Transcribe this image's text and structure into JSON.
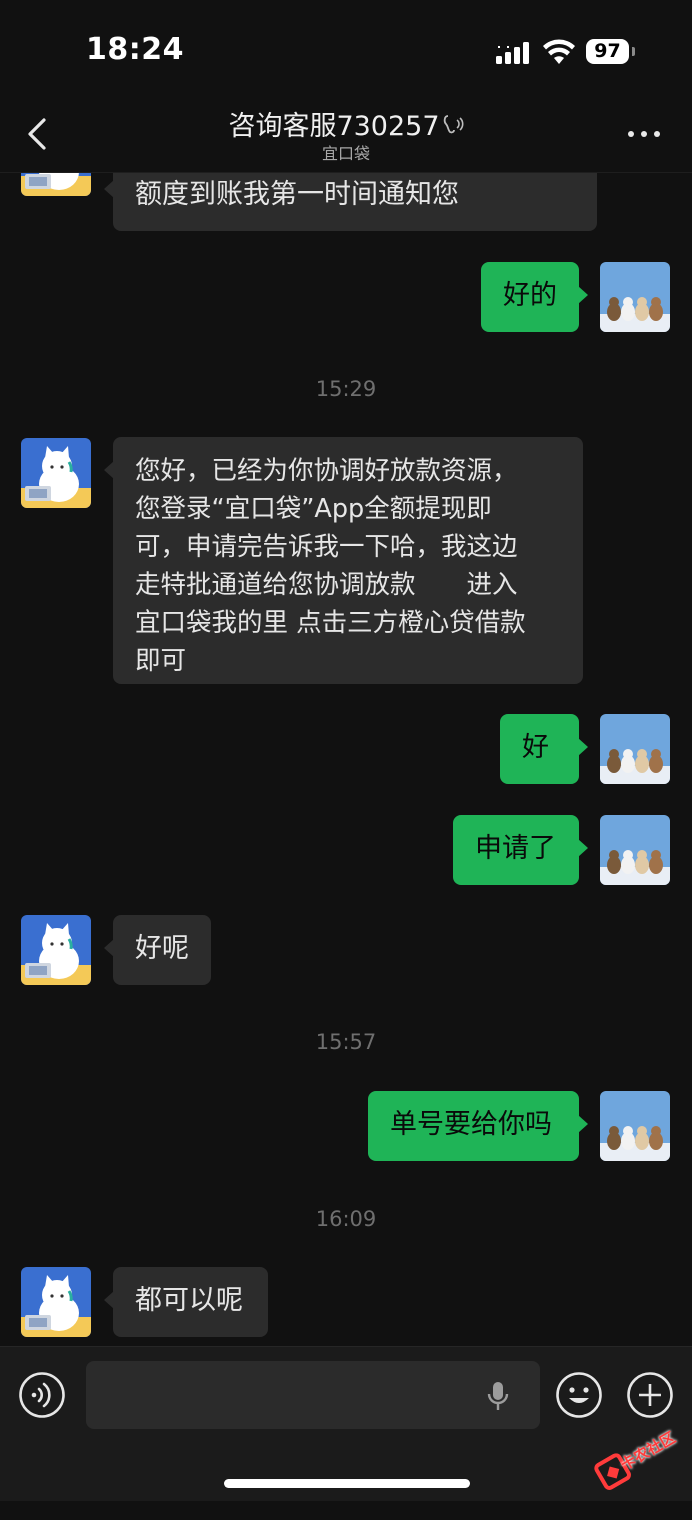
{
  "status_bar": {
    "time": "18:24",
    "battery": "97",
    "icons": [
      "signal-icon",
      "wifi-icon",
      "battery-icon"
    ]
  },
  "header": {
    "title": "咨询客服730257",
    "subtitle": "宜口袋",
    "icons": [
      "back-icon",
      "earpiece-icon",
      "more-icon"
    ]
  },
  "messages": [
    {
      "side": "in",
      "text": "额度到账我第一时间通知您"
    },
    {
      "side": "out",
      "text": "好的"
    },
    {
      "type": "time",
      "text": "15:29"
    },
    {
      "side": "in",
      "text": "您好，已经为你协调好放款资源，\n您登录“宜口袋”App全额提现即\n可，申请完告诉我一下哈，我这边\n走特批通道给您协调放款　　进入\n宜口袋我的里 点击三方橙心贷借款\n即可"
    },
    {
      "side": "out",
      "text": "好"
    },
    {
      "side": "out",
      "text": "申请了"
    },
    {
      "side": "in",
      "text": "好呢"
    },
    {
      "type": "time",
      "text": "15:57"
    },
    {
      "side": "out",
      "text": "单号要给你吗"
    },
    {
      "type": "time",
      "text": "16:09"
    },
    {
      "side": "in",
      "text": "都可以呢"
    }
  ],
  "input_bar": {
    "placeholder": "",
    "icons": [
      "voice-icon",
      "mic-icon",
      "emoji-icon",
      "plus-icon"
    ]
  },
  "watermark": {
    "text": "卡农社区"
  },
  "colors": {
    "background": "#111111",
    "bubble_in": "#2c2c2c",
    "bubble_out": "#1fb457",
    "timestamp": "#6f6f6f"
  }
}
